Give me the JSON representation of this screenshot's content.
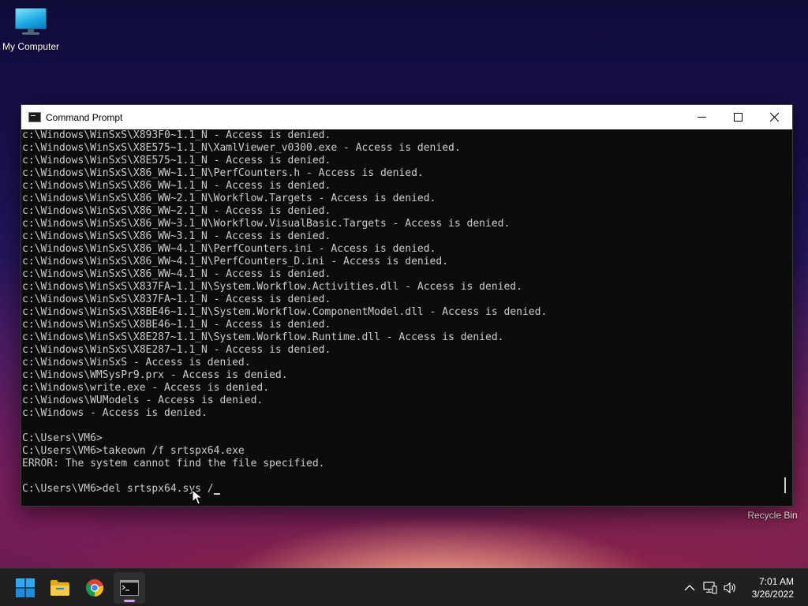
{
  "desktop": {
    "icons": [
      {
        "label": "My Computer",
        "icon": "monitor-icon"
      },
      {
        "label": "Recycle Bin",
        "icon": "recycle-bin-icon"
      }
    ]
  },
  "window": {
    "title": "Command Prompt",
    "icon": "cmd-icon",
    "controls": [
      "minimize-icon",
      "maximize-icon",
      "close-icon"
    ]
  },
  "console": {
    "lines": [
      "c:\\Windows\\WinSxS\\X893F0~1.1_N - Access is denied.",
      "c:\\Windows\\WinSxS\\X8E575~1.1_N\\XamlViewer_v0300.exe - Access is denied.",
      "c:\\Windows\\WinSxS\\X8E575~1.1_N - Access is denied.",
      "c:\\Windows\\WinSxS\\X86_WW~1.1_N\\PerfCounters.h - Access is denied.",
      "c:\\Windows\\WinSxS\\X86_WW~1.1_N - Access is denied.",
      "c:\\Windows\\WinSxS\\X86_WW~2.1_N\\Workflow.Targets - Access is denied.",
      "c:\\Windows\\WinSxS\\X86_WW~2.1_N - Access is denied.",
      "c:\\Windows\\WinSxS\\X86_WW~3.1_N\\Workflow.VisualBasic.Targets - Access is denied.",
      "c:\\Windows\\WinSxS\\X86_WW~3.1_N - Access is denied.",
      "c:\\Windows\\WinSxS\\X86_WW~4.1_N\\PerfCounters.ini - Access is denied.",
      "c:\\Windows\\WinSxS\\X86_WW~4.1_N\\PerfCounters_D.ini - Access is denied.",
      "c:\\Windows\\WinSxS\\X86_WW~4.1_N - Access is denied.",
      "c:\\Windows\\WinSxS\\X837FA~1.1_N\\System.Workflow.Activities.dll - Access is denied.",
      "c:\\Windows\\WinSxS\\X837FA~1.1_N - Access is denied.",
      "c:\\Windows\\WinSxS\\X8BE46~1.1_N\\System.Workflow.ComponentModel.dll - Access is denied.",
      "c:\\Windows\\WinSxS\\X8BE46~1.1_N - Access is denied.",
      "c:\\Windows\\WinSxS\\X8E287~1.1_N\\System.Workflow.Runtime.dll - Access is denied.",
      "c:\\Windows\\WinSxS\\X8E287~1.1_N - Access is denied.",
      "c:\\Windows\\WinSxS - Access is denied.",
      "c:\\Windows\\WMSysPr9.prx - Access is denied.",
      "c:\\Windows\\write.exe - Access is denied.",
      "c:\\Windows\\WUModels - Access is denied.",
      "c:\\Windows - Access is denied.",
      "",
      "C:\\Users\\VM6>",
      "C:\\Users\\VM6>takeown /f srtspx64.exe",
      "ERROR: The system cannot find the file specified.",
      ""
    ],
    "current_input": "C:\\Users\\VM6>del srtspx64.sys /"
  },
  "taskbar": {
    "items": [
      {
        "name": "start",
        "icon": "windows-start-icon"
      },
      {
        "name": "file-explorer",
        "icon": "folder-icon"
      },
      {
        "name": "chrome",
        "icon": "chrome-icon"
      },
      {
        "name": "command-prompt",
        "icon": "cmd-icon",
        "active": true
      }
    ],
    "tray": [
      "chevron-up-icon",
      "network-icon",
      "volume-icon"
    ],
    "time": "7:01 AM",
    "date": "3/26/2022"
  }
}
